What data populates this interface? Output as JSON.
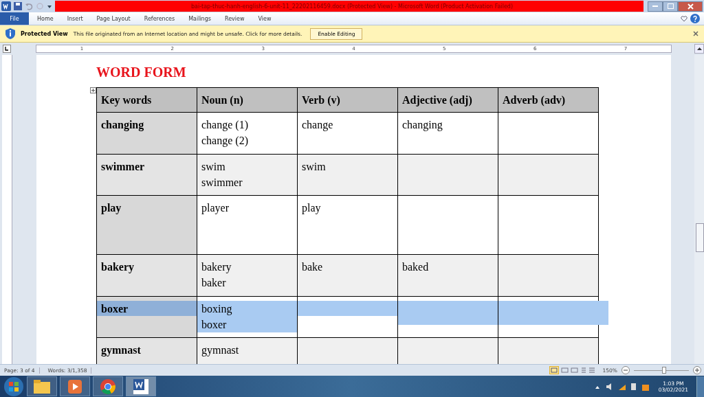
{
  "window": {
    "title": "bai-tap-thuc-hanh-english-6-unit-11_22202116459.docx (Protected View)  -  Microsoft Word (Product Activation Failed)"
  },
  "ribbon": {
    "file_tab": "File",
    "tabs": [
      {
        "label": "Home",
        "selected": false
      },
      {
        "label": "Insert",
        "selected": false
      },
      {
        "label": "Page Layout",
        "selected": false
      },
      {
        "label": "References",
        "selected": false
      },
      {
        "label": "Mailings",
        "selected": false
      },
      {
        "label": "Review",
        "selected": false
      },
      {
        "label": "View",
        "selected": false
      }
    ]
  },
  "message_bar": {
    "label": "Protected View",
    "message": "This file originated from an Internet location and might be unsafe. Click for more details.",
    "button": "Enable Editing"
  },
  "ruler": {
    "numbers": [
      "1",
      "2",
      "3",
      "4",
      "5",
      "6",
      "7"
    ]
  },
  "document": {
    "heading": "WORD FORM",
    "table": {
      "columns": [
        "Key words",
        "Noun (n)",
        "Verb (v)",
        "Adjective (adj)",
        "Adverb (adv)"
      ],
      "rows": [
        {
          "shaded": false,
          "selected": false,
          "cells": [
            [
              "changing"
            ],
            [
              "change (1)",
              "change (2)"
            ],
            [
              "change"
            ],
            [
              "changing"
            ],
            []
          ]
        },
        {
          "shaded": true,
          "selected": false,
          "cells": [
            [
              "swimmer"
            ],
            [
              "swim",
              "swimmer"
            ],
            [
              "swim"
            ],
            [],
            []
          ]
        },
        {
          "shaded": false,
          "selected": false,
          "cells": [
            [
              "play"
            ],
            [
              "player"
            ],
            [
              "play"
            ],
            [],
            []
          ]
        },
        {
          "shaded": true,
          "selected": false,
          "cells": [
            [
              "bakery"
            ],
            [
              "bakery",
              "baker"
            ],
            [
              "bake"
            ],
            [
              "baked"
            ],
            []
          ]
        },
        {
          "shaded": false,
          "selected": true,
          "cells": [
            [
              "boxer"
            ],
            [
              "boxing",
              "boxer"
            ],
            [],
            [],
            []
          ]
        },
        {
          "shaded": true,
          "selected": false,
          "cells": [
            [
              "gymnast"
            ],
            [
              "gymnast"
            ],
            [],
            [],
            []
          ]
        }
      ]
    }
  },
  "status_bar": {
    "page": "Page: 3 of 4",
    "words": "Words: 3/1,358",
    "zoom": "150%",
    "zoom_slider": {
      "level": 0.55
    }
  },
  "taskbar": {
    "time": "1:03 PM",
    "date": "03/02/2021"
  }
}
